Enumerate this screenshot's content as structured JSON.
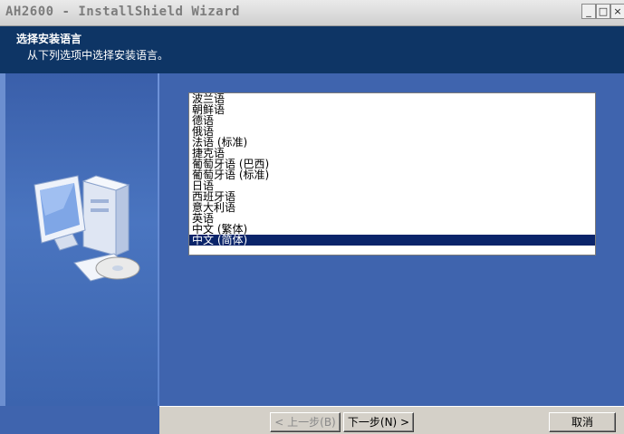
{
  "window": {
    "title": "AH2600 - InstallShield Wizard",
    "minimize_glyph": "_",
    "maximize_glyph": "□",
    "close_glyph": "×"
  },
  "header": {
    "title": "选择安装语言",
    "subtitle": "从下列选项中选择安装语言。"
  },
  "languages": [
    "波兰语",
    "朝鲜语",
    "德语",
    "俄语",
    "法语 (标准)",
    "捷克语",
    "葡萄牙语 (巴西)",
    "葡萄牙语 (标准)",
    "日语",
    "西班牙语",
    "意大利语",
    "英语",
    "中文 (繁体)",
    "中文 (简体)"
  ],
  "selected_language": "中文 (简体)",
  "footer": {
    "back_label": "< 上一步(B)",
    "next_label": "下一步(N) >",
    "cancel_label": "取消"
  },
  "colors": {
    "header_bg": "#0e3565",
    "panel_bg": "#3f64ae",
    "selection": "#0a246a"
  }
}
